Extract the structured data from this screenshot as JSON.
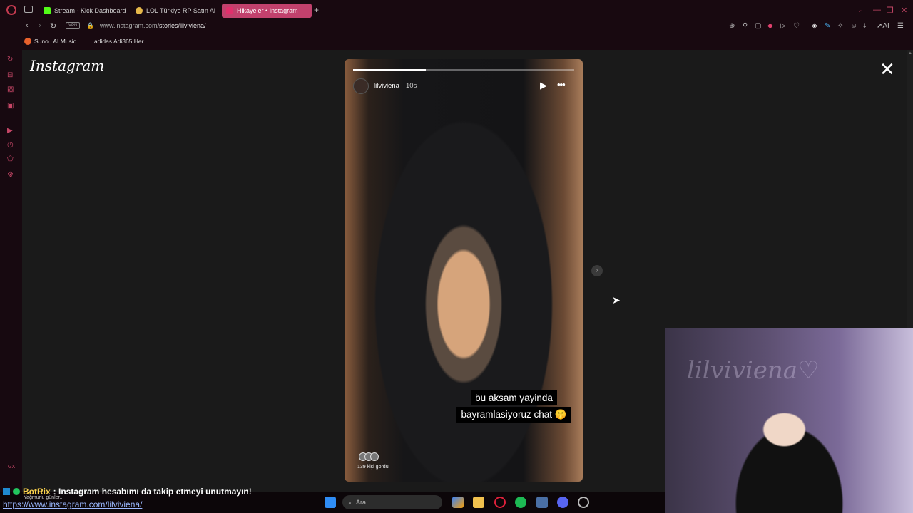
{
  "browser": {
    "tabs": [
      {
        "label": "Stream - Kick Dashboard",
        "active": false,
        "icon_color": "#53fc18"
      },
      {
        "label": "LOL Türkiye RP Satın Al - ",
        "active": false,
        "icon_color": "#e6b84a"
      },
      {
        "label": "Hikayeler • Instagram",
        "active": true,
        "icon_color": "#e1306c"
      }
    ],
    "new_tab": "+",
    "vpn_badge": "VPN",
    "url_host": "www.instagram.com",
    "url_path": "/stories/lilviviena/",
    "ai_label": "AI",
    "bookmarks": [
      {
        "label": "Suno | AI Music"
      },
      {
        "label": "adidas Adi365 Her..."
      }
    ]
  },
  "instagram": {
    "logo": "Instagram",
    "close": "✕",
    "story": {
      "username": "lilviviena",
      "time": "10s",
      "caption_line1": "bu aksam yayinda",
      "caption_line2": "bayramlasiyoruz chat 🤫",
      "viewers": "139 kişi gördü",
      "progress": 0.33
    }
  },
  "chat": {
    "user": "BotRix",
    "message": ": Instagram hesabımı da takip etmeyi unutmayın!",
    "sub": "Yağmurlu günler...",
    "link": "https://www.instagram.com/lilviviena/"
  },
  "sidebar_bottom": "GX",
  "taskbar": {
    "search_placeholder": "Ara"
  },
  "webcam": {
    "sign": "lilviviena♡"
  },
  "colors": {
    "accent": "#c2416d",
    "chrome_bg": "#180910",
    "page_bg": "#1a1a1a"
  }
}
